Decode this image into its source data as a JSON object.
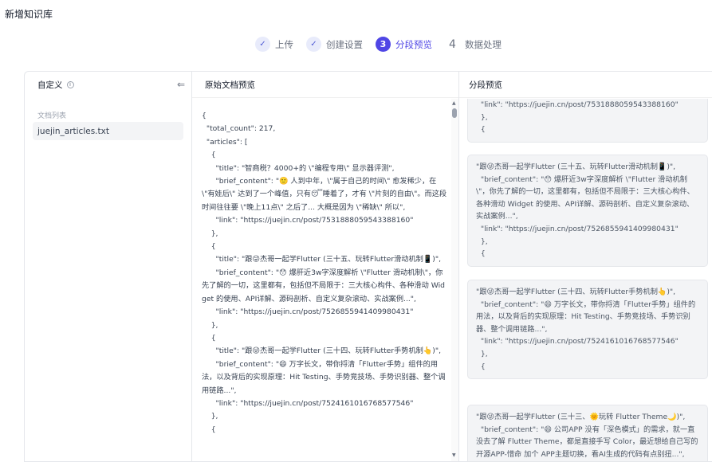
{
  "page": {
    "title": "新增知识库"
  },
  "steps": [
    {
      "icon": "✓",
      "label": "上传",
      "state": "done"
    },
    {
      "icon": "✓",
      "label": "创建设置",
      "state": "done"
    },
    {
      "icon": "3",
      "label": "分段预览",
      "state": "active"
    },
    {
      "icon": "4",
      "label": "数据处理",
      "state": "todo"
    }
  ],
  "left_panel": {
    "title": "自定义",
    "info_icon": "i",
    "collapse_icon": "⇐",
    "file_list_title": "文档列表",
    "files": [
      "juejin_articles.txt"
    ]
  },
  "mid_panel": {
    "title": "原始文档预览",
    "content": "{\n  \"total_count\": 217,\n  \"articles\": [\n    {\n      \"title\": \"智商税？4000+的 \\\"编程专用\\\" 显示器评测\",\n      \"brief_content\": \"🙂 人到中年，\\\"属于自己的时间\\\" 愈发稀少，在 \\\"有娃后\\\" 达到了一个峰值，只有😴睡着了，才有 \\\"片刻的自由\\\"。而这段时间往往要 \\\"晚上11点\\\" 之后了... 大概是因为 \\\"稀缺\\\" 所以\",\n      \"link\": \"https://juejin.cn/post/7531888059543388160\"\n    },\n    {\n      \"title\": \"跟😜杰哥一起学Flutter (三十五、玩转Flutter滑动机制📱)\",\n      \"brief_content\": \"😯 爆肝近3w字深度解析 \\\"Flutter 滑动机制\\\"，你先了解的一切，这里都有，包括但不局限于：三大核心构件、各种滑动 Widget 的使用、API详解、源码剖析、自定义复杂滚动、实战案例...\",\n      \"link\": \"https://juejin.cn/post/7526855941409980431\"\n    },\n    {\n      \"title\": \"跟😜杰哥一起学Flutter (三十四、玩转Flutter手势机制👆)\",\n      \"brief_content\": \"😄 万字长文，带你捋清「Flutter手势」组件的用法，以及背后的实现原理：Hit Testing、手势竞技场、手势识别器、整个调用链路...\",\n      \"link\": \"https://juejin.cn/post/7524161016768577546\"\n    },\n    {"
  },
  "right_panel": {
    "title": "分段预览",
    "chunks": [
      "  \"link\": \"https://juejin.cn/post/7531888059543388160\"\n  },\n  {",
      "\"跟😜杰哥一起学Flutter (三十五、玩转Flutter滑动机制📱)\",\n  \"brief_content\": \"😯 爆肝近3w字深度解析 \\\"Flutter 滑动机制\\\"，你先了解的一切，这里都有，包括但不局限于：三大核心构件、各种滑动 Widget 的使用、API详解、源码剖析、自定义复杂滚动、实战案例...\",\n  \"link\": \"https://juejin.cn/post/7526855941409980431\"\n  },\n  {",
      "\"跟😜杰哥一起学Flutter (三十四、玩转Flutter手势机制👆)\",\n  \"brief_content\": \"😄 万字长文，带你捋清「Flutter手势」组件的用法，以及背后的实现原理：Hit Testing、手势竞技场、手势识别器、整个调用链路...\",\n  \"link\": \"https://juejin.cn/post/7524161016768577546\"\n  },\n  {",
      "\"跟😜杰哥一起学Flutter (三十三、🌞玩转 Flutter Theme🌙)\",\n  \"brief_content\": \"😄 公司APP 没有「深色模式」的需求，就一直没去了解 Flutter Theme，都是直接手写 Color，最近想给自己写的 开源APP-惜命 加个 APP主题切换，看AI生成的代码有点别扭...\","
    ]
  },
  "colors": {
    "accent": "#4f46e5",
    "step_done_bg": "#e8ebfb",
    "chunk_bg": "#f3f4f6",
    "border": "#e5e7eb"
  }
}
